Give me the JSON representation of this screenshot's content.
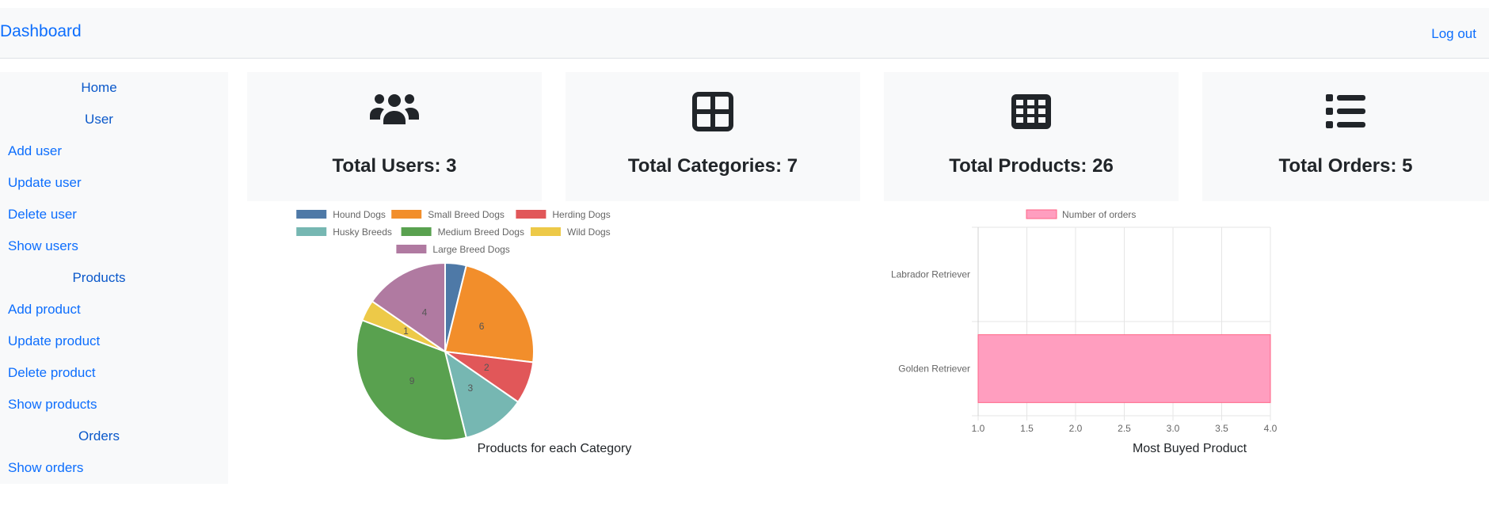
{
  "navbar": {
    "brand": "Dashboard",
    "logout": "Log out"
  },
  "sidebar": {
    "items": [
      {
        "label": "Home",
        "section": true
      },
      {
        "label": "User",
        "section": true
      },
      {
        "label": "Add user",
        "section": false
      },
      {
        "label": "Update user",
        "section": false
      },
      {
        "label": "Delete user",
        "section": false
      },
      {
        "label": "Show users",
        "section": false
      },
      {
        "label": "Products",
        "section": true
      },
      {
        "label": "Add product",
        "section": false
      },
      {
        "label": "Update product",
        "section": false
      },
      {
        "label": "Delete product",
        "section": false
      },
      {
        "label": "Show products",
        "section": false
      },
      {
        "label": "Orders",
        "section": true
      },
      {
        "label": "Show orders",
        "section": false
      }
    ]
  },
  "cards": [
    {
      "icon": "users-icon",
      "title": "Total Users: 3"
    },
    {
      "icon": "categories-icon",
      "title": "Total Categories: 7"
    },
    {
      "icon": "products-grid-icon",
      "title": "Total Products: 26"
    },
    {
      "icon": "list-icon",
      "title": "Total Orders: 5"
    }
  ],
  "chart_data": [
    {
      "type": "pie",
      "title": "Products for each Category",
      "legend_position": "top",
      "categories": [
        "Hound Dogs",
        "Small Breed Dogs",
        "Herding Dogs",
        "Husky Breeds",
        "Medium Breed Dogs",
        "Wild Dogs",
        "Large Breed Dogs"
      ],
      "values": [
        1,
        6,
        2,
        3,
        9,
        1,
        4
      ],
      "colors": [
        "#4e79a7",
        "#f28e2b",
        "#e15759",
        "#76b7b2",
        "#59a14f",
        "#edc948",
        "#b07aa1"
      ]
    },
    {
      "type": "bar",
      "orientation": "horizontal",
      "title": "Most Buyed Product",
      "legend_position": "top",
      "categories": [
        "Labrador Retriever",
        "Golden Retriever"
      ],
      "series": [
        {
          "name": "Number of orders",
          "values": [
            1,
            4
          ],
          "color": "#ff9ebf"
        }
      ],
      "xlim": [
        1,
        4
      ],
      "xticks": [
        "1.0",
        "1.5",
        "2.0",
        "2.5",
        "3.0",
        "3.5",
        "4.0"
      ],
      "grid": true
    }
  ]
}
